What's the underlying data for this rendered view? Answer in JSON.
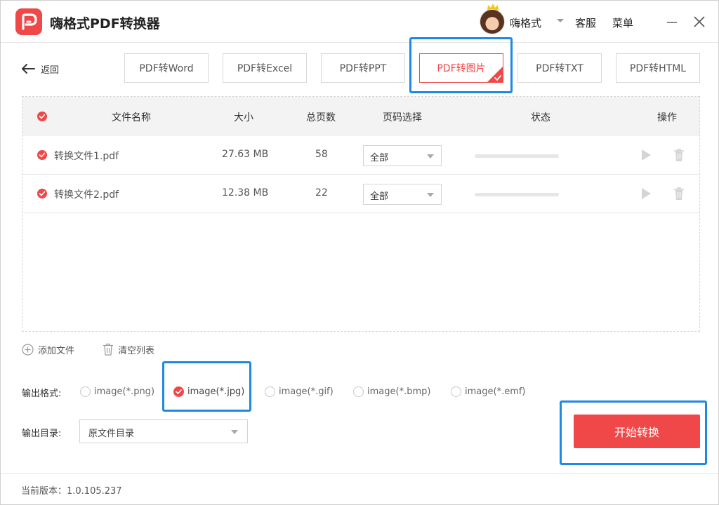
{
  "app": {
    "title": "嗨格式PDF转换器"
  },
  "header": {
    "user_name": "嗨格式",
    "service": "客服",
    "menu": "菜单"
  },
  "nav": {
    "back_label": "返回",
    "tabs": [
      {
        "label": "PDF转Word",
        "active": false
      },
      {
        "label": "PDF转Excel",
        "active": false
      },
      {
        "label": "PDF转PPT",
        "active": false
      },
      {
        "label": "PDF转图片",
        "active": true
      },
      {
        "label": "PDF转TXT",
        "active": false
      },
      {
        "label": "PDF转HTML",
        "active": false
      }
    ]
  },
  "table": {
    "headers": {
      "name": "文件名称",
      "size": "大小",
      "pages": "总页数",
      "page_select": "页码选择",
      "status": "状态",
      "actions": "操作"
    },
    "rows": [
      {
        "name": "转换文件1.pdf",
        "size": "27.63 MB",
        "pages": "58",
        "page_select": "全部",
        "progress": 0
      },
      {
        "name": "转换文件2.pdf",
        "size": "12.38 MB",
        "pages": "22",
        "page_select": "全部",
        "progress": 0
      }
    ]
  },
  "file_actions": {
    "add": "添加文件",
    "clear": "清空列表"
  },
  "output": {
    "format_label": "输出格式:",
    "formats": [
      {
        "label": "image(*.png)",
        "checked": false
      },
      {
        "label": "image(*.jpg)",
        "checked": true
      },
      {
        "label": "image(*.gif)",
        "checked": false
      },
      {
        "label": "image(*.bmp)",
        "checked": false
      },
      {
        "label": "image(*.emf)",
        "checked": false
      }
    ],
    "dir_label": "输出目录:",
    "dir_value": "原文件目录"
  },
  "start_button": "开始转换",
  "footer": {
    "version": "当前版本：1.0.105.237"
  },
  "colors": {
    "accent": "#f04848",
    "highlight": "#1e88e5"
  }
}
